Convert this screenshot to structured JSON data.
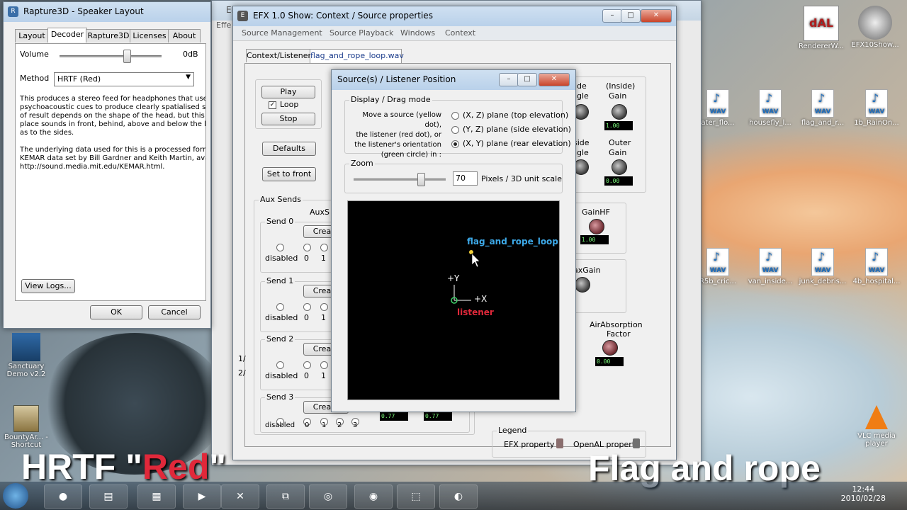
{
  "speaker_window": {
    "title": "Rapture3D - Speaker Layout",
    "tabs": [
      "Layout",
      "Decoder",
      "Rapture3D",
      "Licenses",
      "About"
    ],
    "active_tab": "Decoder",
    "volume_label": "Volume",
    "volume_value": "0dB",
    "method_label": "Method",
    "method_value": "HRTF (Red)",
    "desc1_lines": [
      "This produces a stereo feed for headphones that uses",
      "psychoacoustic cues to produce clearly spatialised sour",
      "of result depends on the shape of the head, but this te",
      "place sounds in front, behind, above and below the list",
      "as to the sides."
    ],
    "desc2_lines": [
      "The underlying data used for this is a processed form o",
      "KEMAR data set by Bill Gardner and Keith Martin, availa",
      "http://sound.media.mit.edu/KEMAR.html."
    ],
    "view_logs": "View Logs...",
    "ok": "OK",
    "cancel": "Cancel"
  },
  "context_window": {
    "title": "EFX 1.0 Show: Context / Source properties",
    "menu": [
      "Source Management",
      "Source Playback",
      "Windows",
      "Context"
    ],
    "tabs": [
      "Context/Listener",
      "flag_and_rope_loop.wav"
    ],
    "play": "Play",
    "loop": "Loop",
    "stop": "Stop",
    "defaults": "Defaults",
    "set_to_front": "Set to front",
    "aux_sends": "Aux Sends",
    "aux_short": "AuxS",
    "sends": [
      {
        "label": "Send 0",
        "create": "Create"
      },
      {
        "label": "Send 1",
        "create": "Create"
      },
      {
        "label": "Send 2",
        "create": "Create"
      },
      {
        "label": "Send 3",
        "create": "Create"
      }
    ],
    "disabled": "disabled",
    "radio_nums": [
      "0",
      "1",
      "2",
      "3"
    ],
    "right_labels": {
      "inside_angle_a": "ide",
      "inside_angle_b": "ngle",
      "inside_gain_a": "(Inside)",
      "inside_gain_b": "Gain",
      "outside_angle_a": "side",
      "outside_angle_b": "ngle",
      "outer_gain_a": "Outer",
      "outer_gain_b": "Gain",
      "gainhf": "GainHF",
      "maxgain": "axGain",
      "air_a": "AirAbsorption",
      "air_b": "Factor"
    },
    "num_values": {
      "inside_gain": "1.00",
      "outer_gain": "0.00",
      "gainhf": "1.00",
      "air": "0.00",
      "send3_a": "0.77",
      "send3_b": "0.77"
    },
    "legend_title": "Legend",
    "legend_efx": "EFX property",
    "legend_openal": "OpenAL property",
    "side_nums": [
      "1/",
      "2/"
    ]
  },
  "position_window": {
    "title": "Source(s) / Listener Position",
    "display_group": "Display / Drag mode",
    "instructions": [
      "Move a source (yellow dot),",
      "the listener (red dot), or",
      "the listener's orientation",
      "(green circle) in :"
    ],
    "options": [
      "(X, Z) plane (top elevation)",
      "(Y, Z) plane (side elevation)",
      "(X, Y) plane (rear elevation)"
    ],
    "selected_option": 2,
    "zoom_group": "Zoom",
    "zoom_value": "70",
    "zoom_unit": "Pixels / 3D unit  scale",
    "zoom_level": 0.75,
    "canvas": {
      "source_label": "flag_and_rope_loop",
      "listener_label": "listener",
      "axis_y": "+Y",
      "axis_x": "+X"
    }
  },
  "back_window": {
    "title_fragments": [
      "EFX",
      "Effe"
    ]
  },
  "desktop": {
    "icons_top": [
      {
        "label": "RendererW...",
        "type": "app"
      },
      {
        "label": "EFX10Show...",
        "type": "app"
      }
    ],
    "wav_row1": [
      "ater_flo...",
      "housefly_l...",
      "flag_and_r...",
      "1b_RainOn..."
    ],
    "wav_row2": [
      "R5b_cric...",
      "van_inside...",
      "junk_debris...",
      "4b_hospital..."
    ],
    "wav_text": "WAV",
    "left_icons": [
      {
        "label": "Sanctuary Demo v2.2"
      },
      {
        "label": "BountyAr... - Shortcut"
      }
    ],
    "vlc_label": "VLC media player"
  },
  "overlay": {
    "left_prefix": "HRTF \"",
    "left_red": "Red",
    "left_suffix": "\"",
    "right": "Flag and rope"
  },
  "taskbar": {
    "clock_time": "12:44",
    "clock_date": "2010/02/28"
  },
  "colors": {
    "source_label": "#3da9e8",
    "listener_label": "#e0283a",
    "source_dot": "#f2d13a",
    "listener_circle": "#3fd16a",
    "titlebar_active": "#b9d1ea"
  }
}
